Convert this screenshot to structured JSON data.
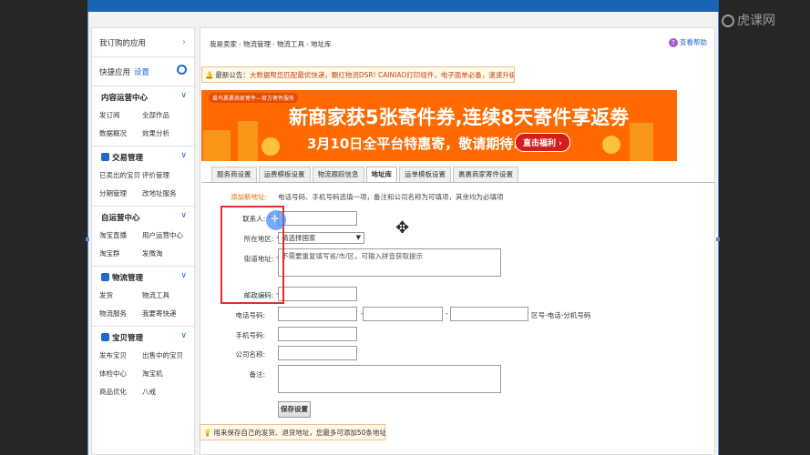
{
  "watermark": "虎课网",
  "sidebar": {
    "top_label": "我订购的应用",
    "quick_label": "快捷应用",
    "quick_settings": "设置",
    "sections": [
      {
        "title": "内容运营中心",
        "items": [
          "发订阅",
          "全部作品",
          "数据概况",
          "效果分析"
        ]
      },
      {
        "title": "交易管理",
        "items": [
          "已卖出的宝贝",
          "评价管理",
          "分期管理",
          "改地址服务"
        ]
      },
      {
        "title": "自运营中心",
        "items": [
          "淘宝直播",
          "用户运营中心",
          "淘宝群",
          "发微淘"
        ]
      },
      {
        "title": "物流管理",
        "items": [
          "发货",
          "物流工具",
          "物流服务",
          "我要寄快递"
        ]
      },
      {
        "title": "宝贝管理",
        "items": [
          "发布宝贝",
          "出售中的宝贝",
          "体检中心",
          "淘宝机",
          "商品优化",
          "八戒"
        ]
      }
    ]
  },
  "breadcrumb": [
    "我是卖家",
    "物流管理",
    "物流工具",
    "地址库"
  ],
  "help_label": "查看帮助",
  "notice": {
    "prefix": "最新公告：",
    "text": "大数据帮您匹配最优快递，飘红物流DSR! CAINIAO打印组件，电子面单必备，速速升级"
  },
  "banner": {
    "top_text": "菜鸟裹裹商家寄件—官方寄件服务",
    "title": "新商家获5张寄件券,连续8天寄件享返劵",
    "subtitle": "3月10日全平台特惠寄，敬请期待...",
    "button": "直击福利"
  },
  "tabs": [
    "服务商设置",
    "运费模板设置",
    "物流跟踪信息",
    "地址库",
    "运单模板设置",
    "裹裹商家寄件设置"
  ],
  "active_tab": "地址库",
  "form": {
    "add_title": "添加新地址:",
    "add_desc": "电话号码、手机号码选填一项，备注和公司名称为可填项，其余均为必填项",
    "contact_label": "联系人:",
    "region_label": "所在地区:",
    "region_value": "请选择国家",
    "street_label": "街道地址:",
    "street_placeholder": "不需要重复填写省/市/区，可输入拼音获取提示",
    "zip_label": "邮政编码:",
    "phone_label": "电话号码:",
    "phone_hint": "区号-电话-分机号码",
    "mobile_label": "手机号码:",
    "company_label": "公司名称:",
    "remark_label": "备注:",
    "required_mark": "*",
    "dash": "-",
    "save_button": "保存设置"
  },
  "tip": "用来保存自己的发货、退货地址，您最多可添加50条地址"
}
